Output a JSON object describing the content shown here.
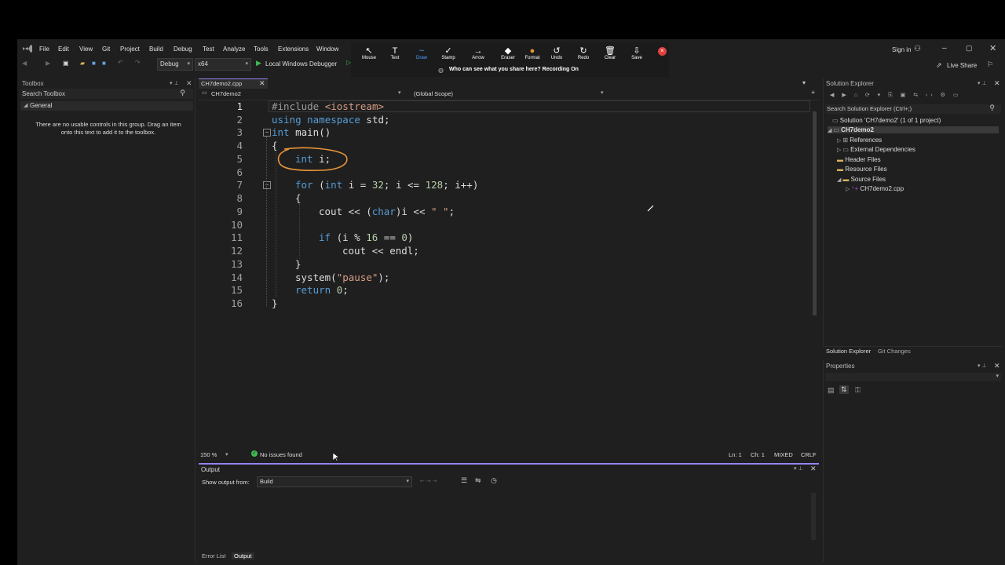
{
  "menu": [
    "File",
    "Edit",
    "View",
    "Git",
    "Project",
    "Build",
    "Debug",
    "Test",
    "Analyze",
    "Tools",
    "Extensions",
    "Window"
  ],
  "toolbar": {
    "config": "Debug",
    "platform": "x64",
    "debugger": "Local Windows Debugger"
  },
  "annotate": {
    "tools": [
      "Mouse",
      "Text",
      "Draw",
      "Stamp",
      "Arrow",
      "Eraser",
      "Format",
      "Undo",
      "Redo",
      "Clear",
      "Save"
    ],
    "notice": "Who can see what you share here? Recording On"
  },
  "account": {
    "sign_in": "Sign in",
    "live_share": "Live Share"
  },
  "toolbox": {
    "title": "Toolbox",
    "search_placeholder": "Search Toolbox",
    "group": "General",
    "empty_msg": "There are no usable controls in this group. Drag an item onto this text to add it to the toolbox."
  },
  "editor": {
    "tab": "CH7demo2.cpp",
    "project_dropdown": "CH7demo2",
    "scope_dropdown": "(Global Scope)",
    "line_numbers": [
      "1",
      "2",
      "3",
      "4",
      "5",
      "6",
      "7",
      "8",
      "9",
      "10",
      "11",
      "12",
      "13",
      "14",
      "15",
      "16"
    ],
    "code": {
      "l1a": "#include ",
      "l1b": "<iostream>",
      "l2a": "using namespace ",
      "l2b": "std;",
      "l3a": "int ",
      "l3b": "main()",
      "l4": "{",
      "l5a": "int ",
      "l5b": "i;",
      "l7a": "for ",
      "l7b": "(",
      "l7c": "int ",
      "l7d": "i = ",
      "l7e": "32",
      "l7f": "; i <= ",
      "l7g": "128",
      "l7h": "; i++)",
      "l8": "{",
      "l9a": "cout << (",
      "l9b": "char",
      "l9c": ")i << ",
      "l9d": "\" \"",
      "l9e": ";",
      "l11a": "if ",
      "l11b": "(i % ",
      "l11c": "16",
      " l11d": "",
      "l11e": " == ",
      "l11f": "0",
      "l11g": ")",
      "l12": "cout << endl;",
      "l13": "}",
      "l14a": "system(",
      "l14b": "\"pause\"",
      "l14c": ");",
      "l15a": "return ",
      "l15b": "0",
      "l15c": ";",
      "l16": "}"
    }
  },
  "status": {
    "zoom": "150 %",
    "issues": "No issues found",
    "ln": "Ln: 1",
    "ch": "Ch: 1",
    "encoding": "MIXED",
    "eol": "CRLF"
  },
  "output": {
    "title": "Output",
    "show_from_label": "Show output from:",
    "source": "Build"
  },
  "bottom_tabs": [
    "Error List",
    "Output"
  ],
  "solution_explorer": {
    "title": "Solution Explorer",
    "search_placeholder": "Search Solution Explorer (Ctrl+;)",
    "solution": "Solution 'CH7demo2' (1 of 1 project)",
    "project": "CH7demo2",
    "nodes": [
      "References",
      "External Dependencies",
      "Header Files",
      "Resource Files",
      "Source Files"
    ],
    "file": "CH7demo2.cpp",
    "tabs": [
      "Solution Explorer",
      "Git Changes"
    ]
  },
  "properties": {
    "title": "Properties"
  },
  "colors": {
    "accent": "#9184ee",
    "annotation": "#e8953a",
    "record": "#e04040"
  }
}
